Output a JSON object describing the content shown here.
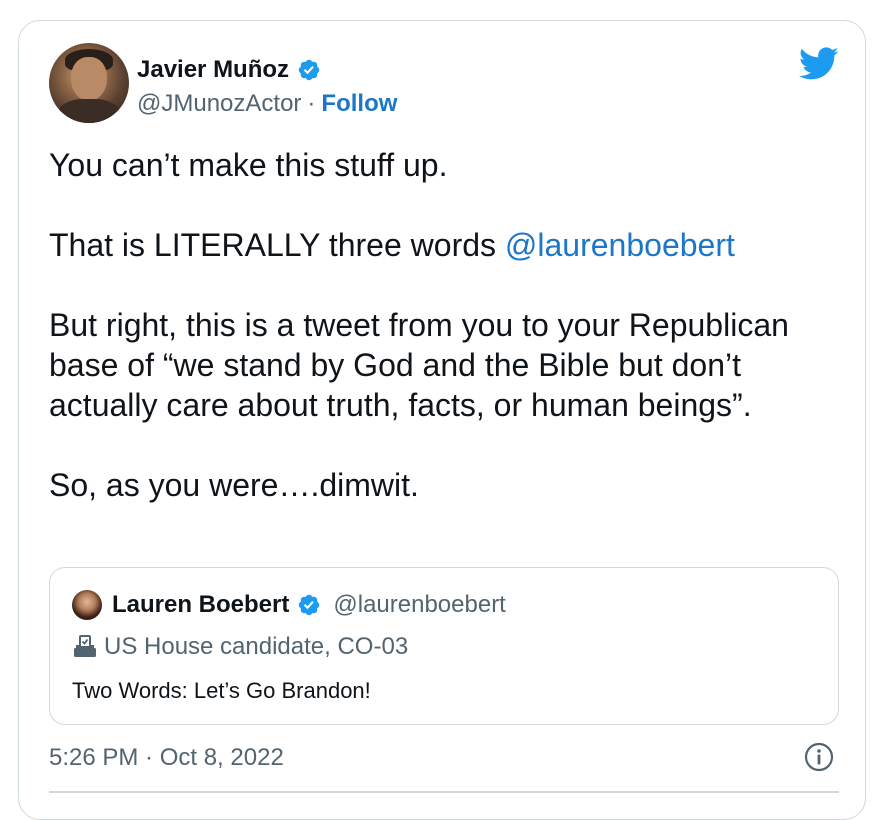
{
  "tweet": {
    "author": {
      "name": "Javier Muñoz",
      "handle": "@JMunozActor",
      "separator": "·",
      "follow_label": "Follow",
      "verified": true
    },
    "text": {
      "line1": "You can’t make this stuff up.",
      "line2_prefix": "That is LITERALLY three words ",
      "line2_mention": "@laurenboebert",
      "line3": "But right, this is a tweet from you to your Republican base of “we stand by God and the Bible but don’t actually care about truth, facts, or human beings”.",
      "line4": "So, as you were….dimwit."
    },
    "quoted": {
      "name": "Lauren Boebert",
      "handle": "@laurenboebert",
      "verified": true,
      "bio_label": "US House candidate, CO-03",
      "text": "Two Words: Let’s Go Brandon!"
    },
    "timestamp": "5:26 PM · Oct 8, 2022"
  },
  "icons": {
    "brand": "twitter-bird-icon",
    "verified": "verified-badge-icon",
    "ballot": "ballot-box-icon",
    "info": "info-icon"
  },
  "colors": {
    "accent": "#1d9bf0",
    "link": "#1d77c9",
    "text": "#0f1419",
    "secondary": "#536471",
    "border": "#cfd9de"
  }
}
